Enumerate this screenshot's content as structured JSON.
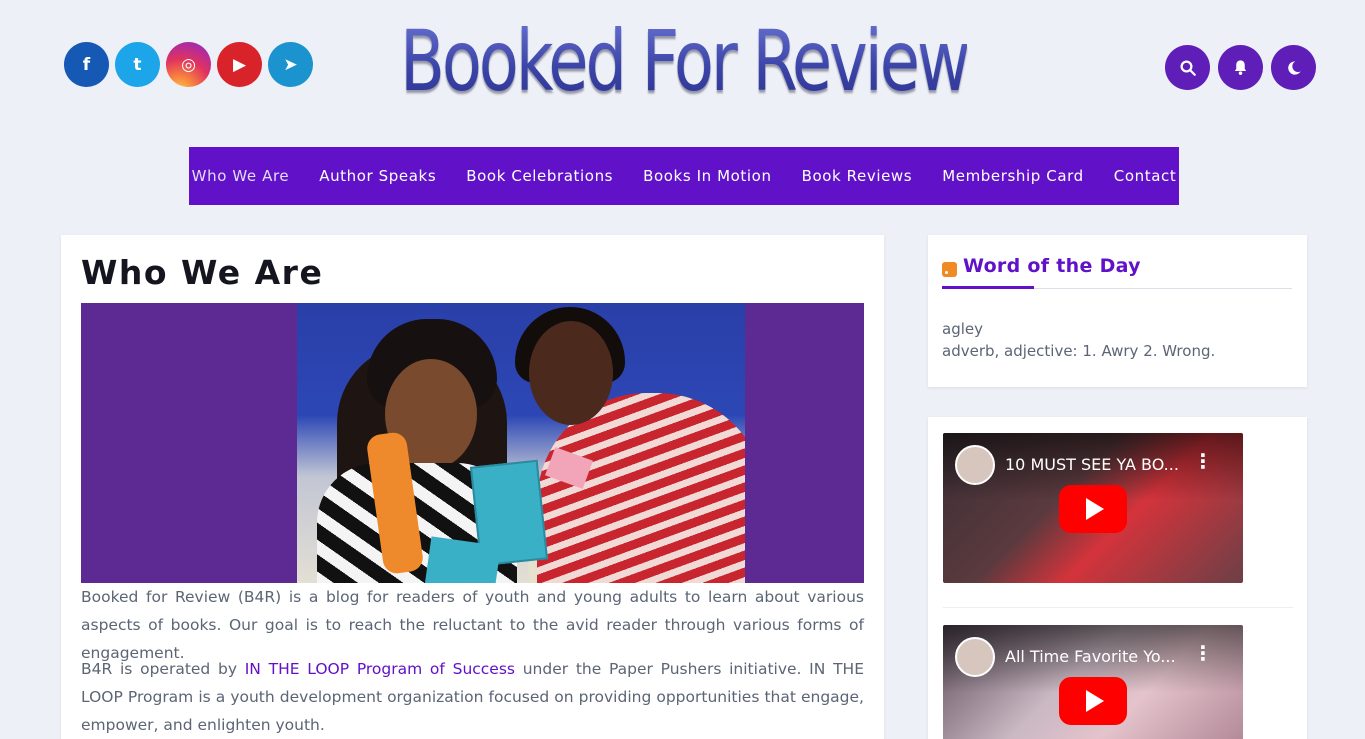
{
  "site": {
    "logo_text": "Booked For Review"
  },
  "social": [
    {
      "name": "facebook",
      "glyph": "f"
    },
    {
      "name": "twitter",
      "glyph": "t"
    },
    {
      "name": "instagram",
      "glyph": "◎"
    },
    {
      "name": "youtube",
      "glyph": "▶"
    },
    {
      "name": "telegram",
      "glyph": "➤"
    }
  ],
  "nav": {
    "items": [
      {
        "label": "Who We Are"
      },
      {
        "label": "Author Speaks"
      },
      {
        "label": "Book Celebrations"
      },
      {
        "label": "Books In Motion"
      },
      {
        "label": "Book Reviews"
      },
      {
        "label": "Membership Card"
      },
      {
        "label": "Contact"
      }
    ]
  },
  "page": {
    "title": "Who We Are",
    "paragraph1": "Booked for Review (B4R) is a blog for readers of youth and young adults to learn about various aspects of books. Our goal is to reach the reluctant to the avid reader through various forms of engagement.",
    "paragraph2_pre": "B4R is operated by ",
    "paragraph2_link": "IN THE LOOP Program of Success",
    "paragraph2_post": " under the Paper Pushers initiative. IN THE LOOP Program is a youth development organization focused on providing opportunities that engage, empower, and enlighten youth."
  },
  "sidebar": {
    "word_of_day": {
      "title": "Word of the Day",
      "word": "agley",
      "definition": "adverb, adjective: 1. Awry 2. Wrong."
    },
    "videos": [
      {
        "title": "10 MUST SEE YA BO..."
      },
      {
        "title": "All Time Favorite Yo..."
      }
    ]
  },
  "colors": {
    "accent": "#6112c8",
    "background": "#edf0f6"
  }
}
